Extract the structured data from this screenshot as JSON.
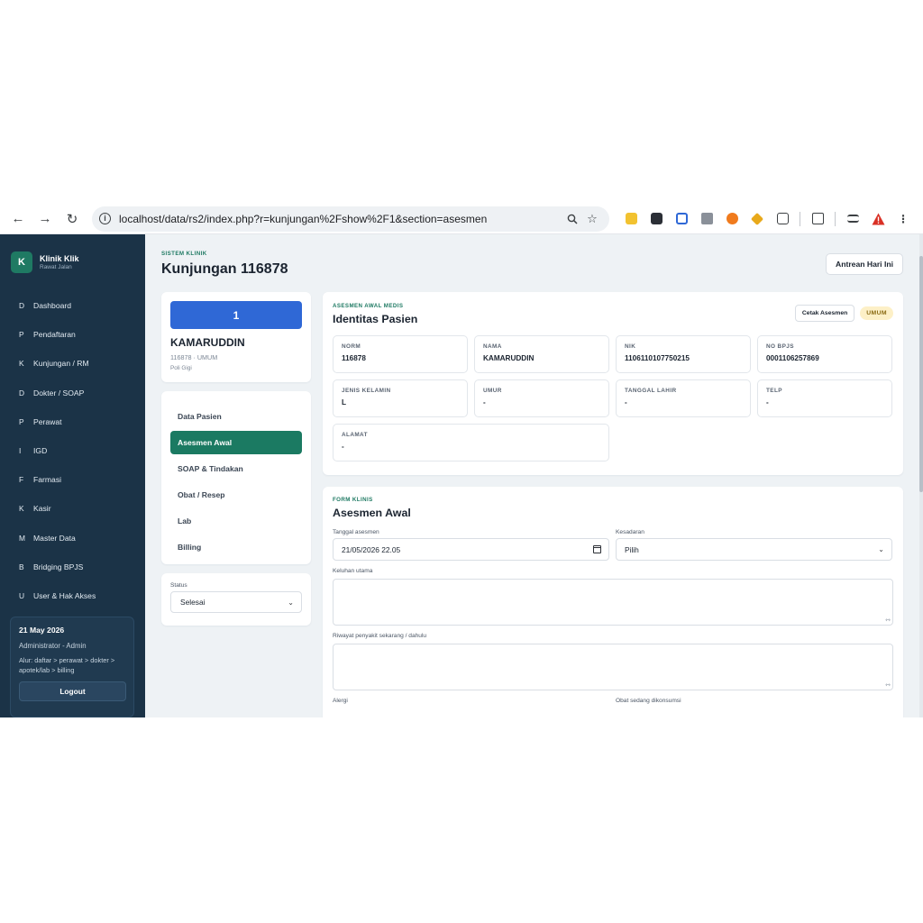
{
  "browser": {
    "url": "localhost/data/rs2/index.php?r=kunjungan%2Fshow%2F1&section=asesmen",
    "back_icon": "←",
    "forward_icon": "→",
    "reload_icon": "↻"
  },
  "sidebar": {
    "logo_letter": "K",
    "brand_title": "Klinik Klik",
    "brand_subtitle": "Rawat Jalan",
    "items": [
      {
        "letter": "D",
        "label": "Dashboard"
      },
      {
        "letter": "P",
        "label": "Pendaftaran"
      },
      {
        "letter": "K",
        "label": "Kunjungan / RM"
      },
      {
        "letter": "D",
        "label": "Dokter / SOAP"
      },
      {
        "letter": "P",
        "label": "Perawat"
      },
      {
        "letter": "I",
        "label": "IGD"
      },
      {
        "letter": "F",
        "label": "Farmasi"
      },
      {
        "letter": "K",
        "label": "Kasir"
      },
      {
        "letter": "M",
        "label": "Master Data"
      },
      {
        "letter": "B",
        "label": "Bridging BPJS"
      },
      {
        "letter": "U",
        "label": "User & Hak Akses"
      }
    ],
    "footer": {
      "date": "21 May 2026",
      "user": "Administrator - Admin",
      "flow": "Alur: daftar > perawat > dokter > apotek/lab > billing",
      "logout_label": "Logout"
    }
  },
  "header": {
    "eyebrow": "SISTEM KLINIK",
    "title": "Kunjungan 116878",
    "queue_button": "Antrean Hari Ini"
  },
  "patient_card": {
    "queue_number": "1",
    "name": "KAMARUDDIN",
    "meta": "116878 · UMUM",
    "poli": "Poli Gigi"
  },
  "sections": {
    "items": [
      "Data Pasien",
      "Asesmen Awal",
      "SOAP & Tindakan",
      "Obat / Resep",
      "Lab",
      "Billing"
    ],
    "active_index": 1
  },
  "status": {
    "label": "Status",
    "value": "Selesai"
  },
  "identity": {
    "eyebrow": "ASESMEN AWAL MEDIS",
    "title": "Identitas Pasien",
    "print_button": "Cetak Asesmen",
    "badge": "UMUM",
    "fields": [
      {
        "key": "NORM",
        "value": "116878"
      },
      {
        "key": "NAMA",
        "value": "KAMARUDDIN"
      },
      {
        "key": "NIK",
        "value": "1106110107750215"
      },
      {
        "key": "NO BPJS",
        "value": "0001106257869"
      },
      {
        "key": "JENIS KELAMIN",
        "value": "L"
      },
      {
        "key": "UMUR",
        "value": "-"
      },
      {
        "key": "TANGGAL LAHIR",
        "value": "-"
      },
      {
        "key": "TELP",
        "value": "-"
      },
      {
        "key": "ALAMAT",
        "value": "-"
      }
    ]
  },
  "form": {
    "eyebrow": "FORM KLINIS",
    "title": "Asesmen Awal",
    "date_label": "Tanggal asesmen",
    "date_value": "21/05/2026 22.05",
    "consciousness_label": "Kesadaran",
    "consciousness_value": "Pilih",
    "complaint_label": "Keluhan utama",
    "history_label": "Riwayat penyakit sekarang / dahulu",
    "allergy_label": "Alergi",
    "medication_label": "Obat sedang dikonsumsi"
  },
  "colors": {
    "sidebar_bg": "#1b3347",
    "accent_green": "#1b7a62",
    "queue_blue": "#2f68d6",
    "badge_bg": "#fdf0c7",
    "page_bg": "#eef2f5"
  }
}
